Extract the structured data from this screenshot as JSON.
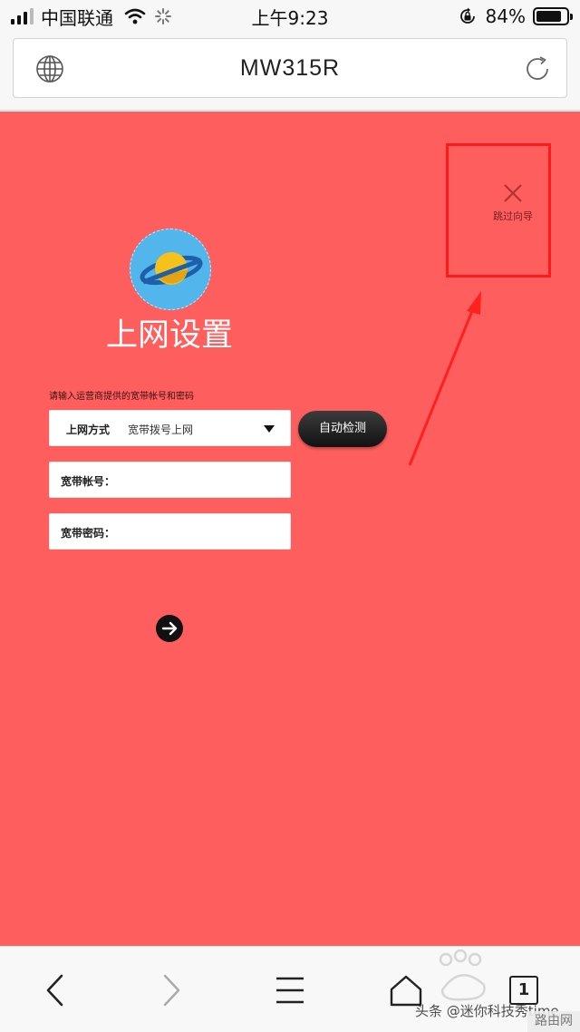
{
  "status_bar": {
    "carrier": "中国联通",
    "time": "上午9:23",
    "battery_text": "84%",
    "battery_level_percent": 84,
    "icons": [
      "signal-icon",
      "wifi-icon",
      "loading-spinner-icon",
      "orientation-lock-icon",
      "battery-icon"
    ]
  },
  "browser": {
    "title": "MW315R",
    "icons": [
      "globe-icon",
      "reload-icon"
    ]
  },
  "page": {
    "skip_label": "跳过向导",
    "title": "上网设置",
    "hint": "请输入运营商提供的宽带帐号和密码",
    "method_label": "上网方式",
    "method_value": "宽带拨号上网",
    "auto_detect_label": "自动检测",
    "account_label": "宽带帐号：",
    "account_value": "",
    "password_label": "宽带密码：",
    "password_value": "",
    "background_color": "#fe5f5e",
    "annotation_color": "#ff1a1a"
  },
  "toolbar": {
    "tab_count": "1",
    "icons": [
      "back-icon",
      "forward-icon",
      "menu-icon",
      "home-icon",
      "tabs-icon"
    ]
  },
  "watermark": {
    "text": "头条 @迷你科技秀time",
    "corner": "路由网"
  }
}
